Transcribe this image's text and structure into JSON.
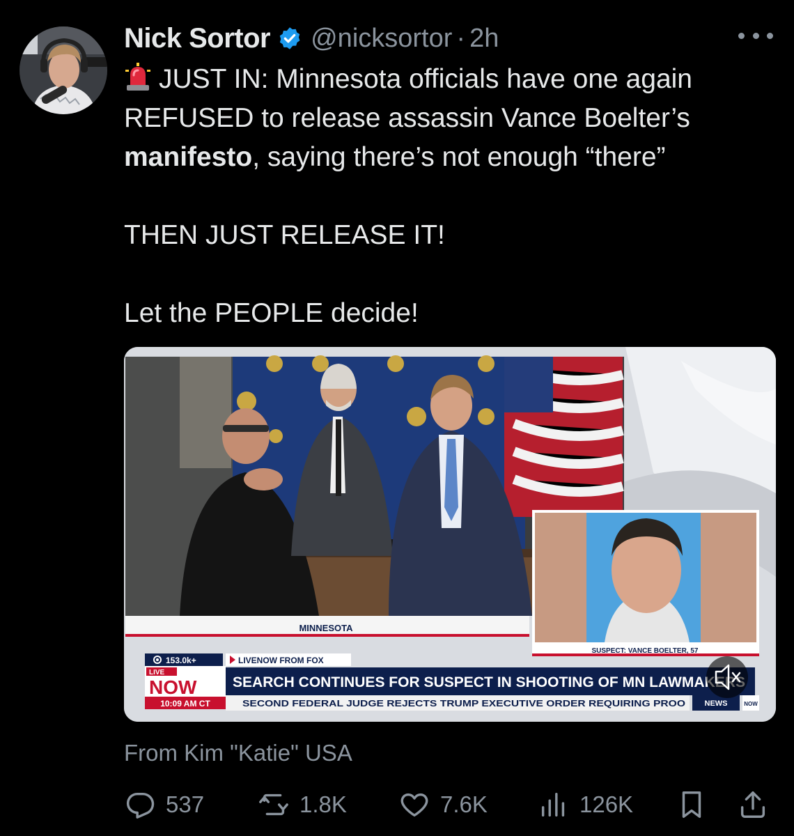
{
  "author": {
    "name": "Nick Sortor",
    "handle": "@nicksortor",
    "separator": "·",
    "time": "2h"
  },
  "icons": {
    "verified": "verified-badge-icon",
    "more": "more-options-icon",
    "siren": "police-siren-emoji",
    "reply": "reply-icon",
    "repost": "repost-icon",
    "like": "heart-icon",
    "views": "views-chart-icon",
    "bookmark": "bookmark-icon",
    "share": "share-icon",
    "mute": "muted-speaker-icon"
  },
  "tweet": {
    "line1_prefix": "JUST IN: Minnesota officials have one again",
    "line2": "REFUSED to release assassin Vance Boelter’s",
    "line3_bold": "manifesto",
    "line3_rest": ", saying there’s not enough “there”",
    "line4": "THEN JUST RELEASE IT!",
    "line5": "Let the PEOPLE decide!"
  },
  "video": {
    "location_label": "MINNESOTA",
    "inset_caption": "SUSPECT: VANCE BOELTER, 57",
    "viewers": "153.0k+",
    "live_label": "LIVE",
    "now_label": "NOW",
    "clock": "10:09 AM CT",
    "source_tag": "LIVENOW FROM FOX",
    "headline": "SEARCH CONTINUES FOR SUSPECT IN SHOOTING OF MN LAWMAKERS",
    "ticker": "SECOND FEDERAL JUDGE REJECTS TRUMP EXECUTIVE ORDER REQUIRING PROO",
    "news_label": "NEWS",
    "corner_label": "NOW"
  },
  "source_credit": "From Kim \"Katie\" USA",
  "stats": {
    "replies": "537",
    "reposts": "1.8K",
    "likes": "7.6K",
    "views": "126K"
  },
  "colors": {
    "background": "#000000",
    "text": "#e7e9ea",
    "muted": "#8b949e",
    "verified": "#1d9bf0",
    "fox_red": "#c8102e",
    "fox_navy": "#0d1f4c"
  }
}
